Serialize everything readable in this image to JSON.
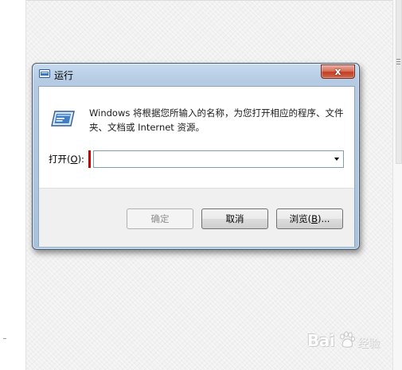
{
  "dialog": {
    "title": "运行",
    "close_label": "x",
    "description": "Windows 将根据您所输入的名称，为您打开相应的程序、文件夹、文档或 Internet 资源。",
    "open_label_prefix": "打开(",
    "open_label_mnemonic": "O",
    "open_label_suffix": "):",
    "open_value": "",
    "buttons": {
      "ok": "确定",
      "cancel": "取消",
      "browse_prefix": "浏览(",
      "browse_mnemonic": "B",
      "browse_suffix": ")..."
    }
  },
  "watermark": {
    "brand": "Bai",
    "suffix": "经验"
  },
  "colors": {
    "close_button": "#c94a2f",
    "frame": "#b4cbe3",
    "highlight_mark": "#cc0000"
  },
  "icons": {
    "title": "run-dialog-icon",
    "main": "run-program-icon",
    "dropdown": "dropdown-arrow-icon",
    "close": "close-icon",
    "watermark": "baidu-paw-icon"
  }
}
